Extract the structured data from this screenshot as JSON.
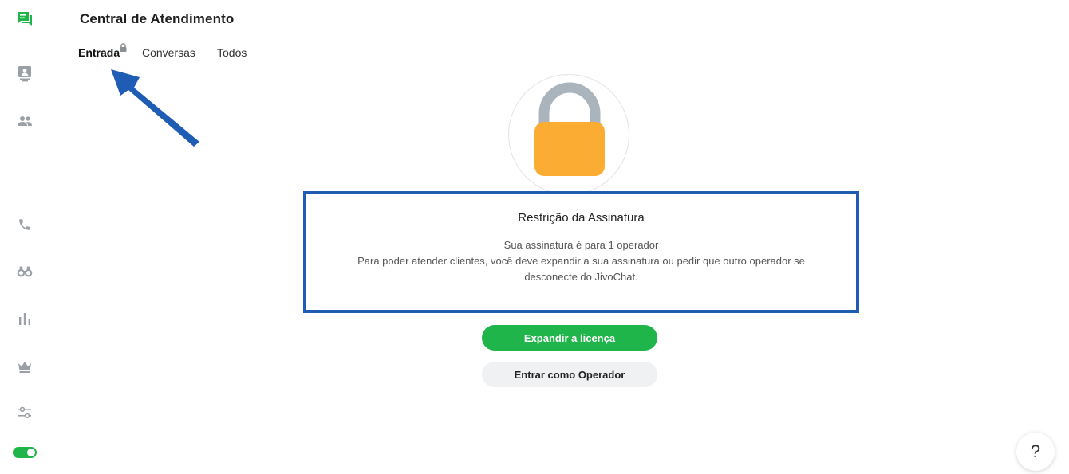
{
  "header": {
    "title": "Central de Atendimento"
  },
  "tabs": [
    {
      "label": "Entrada",
      "active": true,
      "locked": true
    },
    {
      "label": "Conversas",
      "active": false
    },
    {
      "label": "Todos",
      "active": false
    }
  ],
  "sidebar": {
    "items": [
      {
        "icon": "chat-icon",
        "active": true
      },
      {
        "icon": "visitors-icon"
      },
      {
        "icon": "team-icon"
      },
      {
        "icon": "phone-icon"
      },
      {
        "icon": "binoculars-icon"
      },
      {
        "icon": "stats-icon"
      },
      {
        "icon": "crown-icon"
      },
      {
        "icon": "settings-sliders-icon"
      }
    ],
    "status_toggle": {
      "on": true,
      "color": "#1fb54a"
    }
  },
  "restriction": {
    "title": "Restrição da Assinatura",
    "line1": "Sua assinatura é para 1 operador",
    "line2": "Para poder atender clientes, você deve expandir a sua assinatura ou pedir que outro operador se",
    "line3": "desconecte do JivoChat."
  },
  "buttons": {
    "expand_label": "Expandir a licença",
    "operator_label": "Entrar como Operador"
  },
  "help": {
    "label": "?"
  },
  "colors": {
    "accent": "#1fb54a",
    "lock_body": "#fbad33",
    "lock_shackle": "#aab4bd",
    "annotation": "#1f5db5"
  }
}
